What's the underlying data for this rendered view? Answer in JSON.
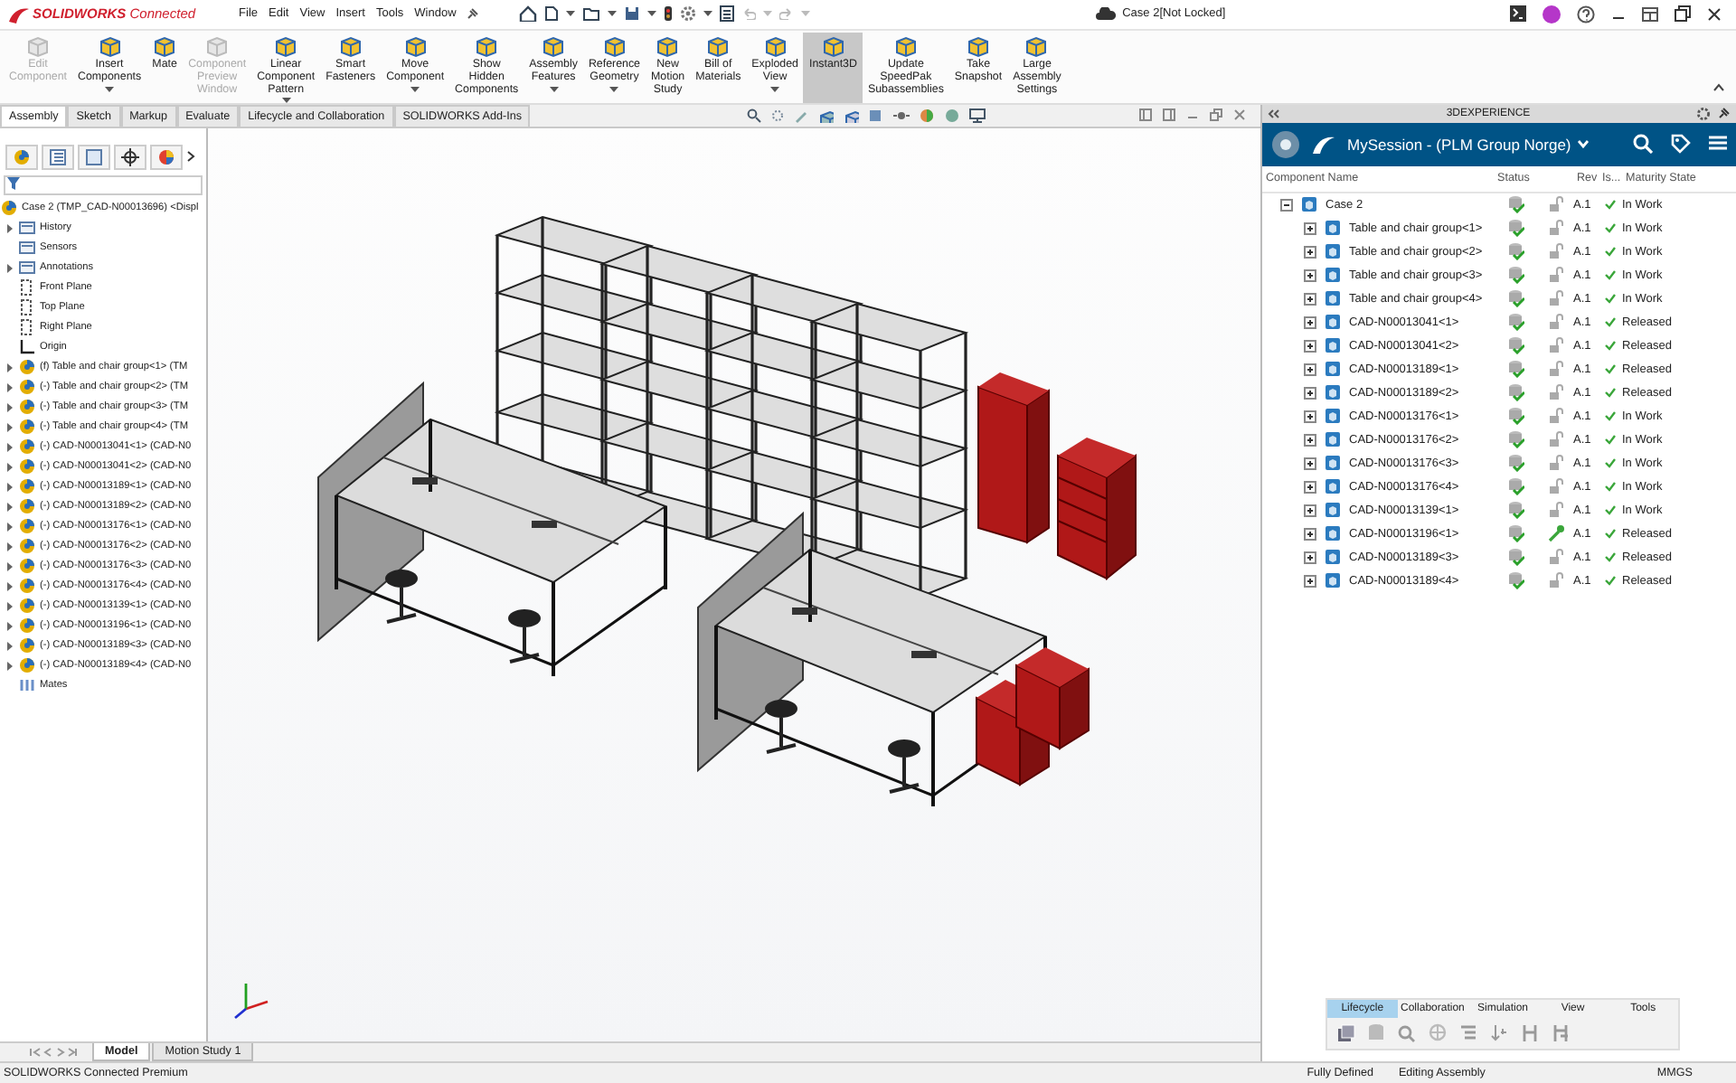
{
  "title_bar": {
    "app_name": "**SOLIDWORKS** Connected",
    "menu": [
      "File",
      "Edit",
      "View",
      "Insert",
      "Tools",
      "Window"
    ],
    "document_title": "Case 2[Not Locked]"
  },
  "ribbon": {
    "buttons": [
      {
        "label": "Edit Component",
        "disabled": true,
        "dropdown": false,
        "selected": false
      },
      {
        "label": "Insert Components",
        "disabled": false,
        "dropdown": true,
        "selected": false
      },
      {
        "label": "Mate",
        "disabled": false,
        "dropdown": false,
        "selected": false
      },
      {
        "label": "Component Preview Window",
        "disabled": true,
        "dropdown": false,
        "selected": false
      },
      {
        "label": "Linear Component Pattern",
        "disabled": false,
        "dropdown": true,
        "selected": false
      },
      {
        "label": "Smart Fasteners",
        "disabled": false,
        "dropdown": false,
        "selected": false
      },
      {
        "label": "Move Component",
        "disabled": false,
        "dropdown": true,
        "selected": false
      },
      {
        "label": "Show Hidden Components",
        "disabled": false,
        "dropdown": false,
        "selected": false
      },
      {
        "label": "Assembly Features",
        "disabled": false,
        "dropdown": true,
        "selected": false
      },
      {
        "label": "Reference Geometry",
        "disabled": false,
        "dropdown": true,
        "selected": false
      },
      {
        "label": "New Motion Study",
        "disabled": false,
        "dropdown": false,
        "selected": false
      },
      {
        "label": "Bill of Materials",
        "disabled": false,
        "dropdown": false,
        "selected": false
      },
      {
        "label": "Exploded View",
        "disabled": false,
        "dropdown": true,
        "selected": false
      },
      {
        "label": "Instant3D",
        "disabled": false,
        "dropdown": false,
        "selected": true
      },
      {
        "label": "Update SpeedPak Subassemblies",
        "disabled": false,
        "dropdown": false,
        "selected": false
      },
      {
        "label": "Take Snapshot",
        "disabled": false,
        "dropdown": false,
        "selected": false
      },
      {
        "label": "Large Assembly Settings",
        "disabled": false,
        "dropdown": false,
        "selected": false
      }
    ]
  },
  "command_tabs": [
    {
      "label": "Assembly",
      "selected": true
    },
    {
      "label": "Sketch",
      "selected": false
    },
    {
      "label": "Markup",
      "selected": false
    },
    {
      "label": "Evaluate",
      "selected": false
    },
    {
      "label": "Lifecycle and Collaboration",
      "selected": false
    },
    {
      "label": "SOLIDWORKS Add-Ins",
      "selected": false
    }
  ],
  "feature_tree": {
    "root": "Case 2 (TMP_CAD-N00013696) <Displ",
    "items": [
      {
        "label": "History",
        "kind": "folder",
        "expandable": true
      },
      {
        "label": "Sensors",
        "kind": "folder",
        "expandable": false
      },
      {
        "label": "Annotations",
        "kind": "folder",
        "expandable": true
      },
      {
        "label": "Front Plane",
        "kind": "plane",
        "expandable": false
      },
      {
        "label": "Top Plane",
        "kind": "plane",
        "expandable": false
      },
      {
        "label": "Right Plane",
        "kind": "plane",
        "expandable": false
      },
      {
        "label": "Origin",
        "kind": "origin",
        "expandable": false
      },
      {
        "label": "(f) Table and chair group<1> (TM",
        "kind": "component",
        "expandable": true
      },
      {
        "label": "(-) Table and chair group<2> (TM",
        "kind": "component",
        "expandable": true
      },
      {
        "label": "(-) Table and chair group<3> (TM",
        "kind": "component",
        "expandable": true
      },
      {
        "label": "(-) Table and chair group<4> (TM",
        "kind": "component",
        "expandable": true
      },
      {
        "label": "(-) CAD-N00013041<1> (CAD-N0",
        "kind": "component",
        "expandable": true
      },
      {
        "label": "(-) CAD-N00013041<2> (CAD-N0",
        "kind": "component",
        "expandable": true
      },
      {
        "label": "(-) CAD-N00013189<1> (CAD-N0",
        "kind": "component",
        "expandable": true
      },
      {
        "label": "(-) CAD-N00013189<2> (CAD-N0",
        "kind": "component",
        "expandable": true
      },
      {
        "label": "(-) CAD-N00013176<1> (CAD-N0",
        "kind": "component",
        "expandable": true
      },
      {
        "label": "(-) CAD-N00013176<2> (CAD-N0",
        "kind": "component",
        "expandable": true
      },
      {
        "label": "(-) CAD-N00013176<3> (CAD-N0",
        "kind": "component",
        "expandable": true
      },
      {
        "label": "(-) CAD-N00013176<4> (CAD-N0",
        "kind": "component",
        "expandable": true
      },
      {
        "label": "(-) CAD-N00013139<1> (CAD-N0",
        "kind": "component",
        "expandable": true
      },
      {
        "label": "(-) CAD-N00013196<1> (CAD-N0",
        "kind": "component",
        "expandable": true
      },
      {
        "label": "(-) CAD-N00013189<3> (CAD-N0",
        "kind": "component",
        "expandable": true
      },
      {
        "label": "(-) CAD-N00013189<4> (CAD-N0",
        "kind": "component",
        "expandable": true
      },
      {
        "label": "Mates",
        "kind": "mates",
        "expandable": false
      }
    ]
  },
  "bottom_tabs": [
    {
      "label": "Model",
      "selected": true
    },
    {
      "label": "Motion Study 1",
      "selected": false
    }
  ],
  "plm_panel": {
    "title": "3DEXPERIENCE",
    "session": "MySession - (PLM Group Norge)",
    "columns": {
      "name": "Component Name",
      "status": "Status",
      "rev": "Rev",
      "is": "Is...",
      "maturity": "Maturity State"
    },
    "rows": [
      {
        "name": "Case 2",
        "rev": "A.1",
        "maturity": "In Work",
        "reserved": false,
        "expanded": true,
        "children": [
          {
            "name": "Table and chair group<1>",
            "rev": "A.1",
            "maturity": "In Work",
            "reserved": false,
            "expanded": false
          },
          {
            "name": "Table and chair group<2>",
            "rev": "A.1",
            "maturity": "In Work",
            "reserved": false,
            "expanded": false
          },
          {
            "name": "Table and chair group<3>",
            "rev": "A.1",
            "maturity": "In Work",
            "reserved": false,
            "expanded": false
          },
          {
            "name": "Table and chair group<4>",
            "rev": "A.1",
            "maturity": "In Work",
            "reserved": false,
            "expanded": false
          },
          {
            "name": "CAD-N00013041<1>",
            "rev": "A.1",
            "maturity": "Released",
            "reserved": false,
            "expanded": false
          },
          {
            "name": "CAD-N00013041<2>",
            "rev": "A.1",
            "maturity": "Released",
            "reserved": false,
            "expanded": false
          },
          {
            "name": "CAD-N00013189<1>",
            "rev": "A.1",
            "maturity": "Released",
            "reserved": false,
            "expanded": false
          },
          {
            "name": "CAD-N00013189<2>",
            "rev": "A.1",
            "maturity": "Released",
            "reserved": false,
            "expanded": false
          },
          {
            "name": "CAD-N00013176<1>",
            "rev": "A.1",
            "maturity": "In Work",
            "reserved": false,
            "expanded": false
          },
          {
            "name": "CAD-N00013176<2>",
            "rev": "A.1",
            "maturity": "In Work",
            "reserved": false,
            "expanded": false
          },
          {
            "name": "CAD-N00013176<3>",
            "rev": "A.1",
            "maturity": "In Work",
            "reserved": false,
            "expanded": false
          },
          {
            "name": "CAD-N00013176<4>",
            "rev": "A.1",
            "maturity": "In Work",
            "reserved": false,
            "expanded": false
          },
          {
            "name": "CAD-N00013139<1>",
            "rev": "A.1",
            "maturity": "In Work",
            "reserved": false,
            "expanded": false
          },
          {
            "name": "CAD-N00013196<1>",
            "rev": "A.1",
            "maturity": "Released",
            "reserved": true,
            "expanded": false
          },
          {
            "name": "CAD-N00013189<3>",
            "rev": "A.1",
            "maturity": "Released",
            "reserved": false,
            "expanded": false
          },
          {
            "name": "CAD-N00013189<4>",
            "rev": "A.1",
            "maturity": "Released",
            "reserved": false,
            "expanded": false
          }
        ]
      }
    ],
    "tabs": [
      {
        "label": "Lifecycle",
        "selected": true
      },
      {
        "label": "Collaboration",
        "selected": false
      },
      {
        "label": "Simulation",
        "selected": false
      },
      {
        "label": "View",
        "selected": false
      },
      {
        "label": "Tools",
        "selected": false
      }
    ]
  },
  "status_bar": {
    "product": "SOLIDWORKS Connected Premium",
    "state": "Fully Defined",
    "mode": "Editing Assembly",
    "units": "MMGS"
  }
}
